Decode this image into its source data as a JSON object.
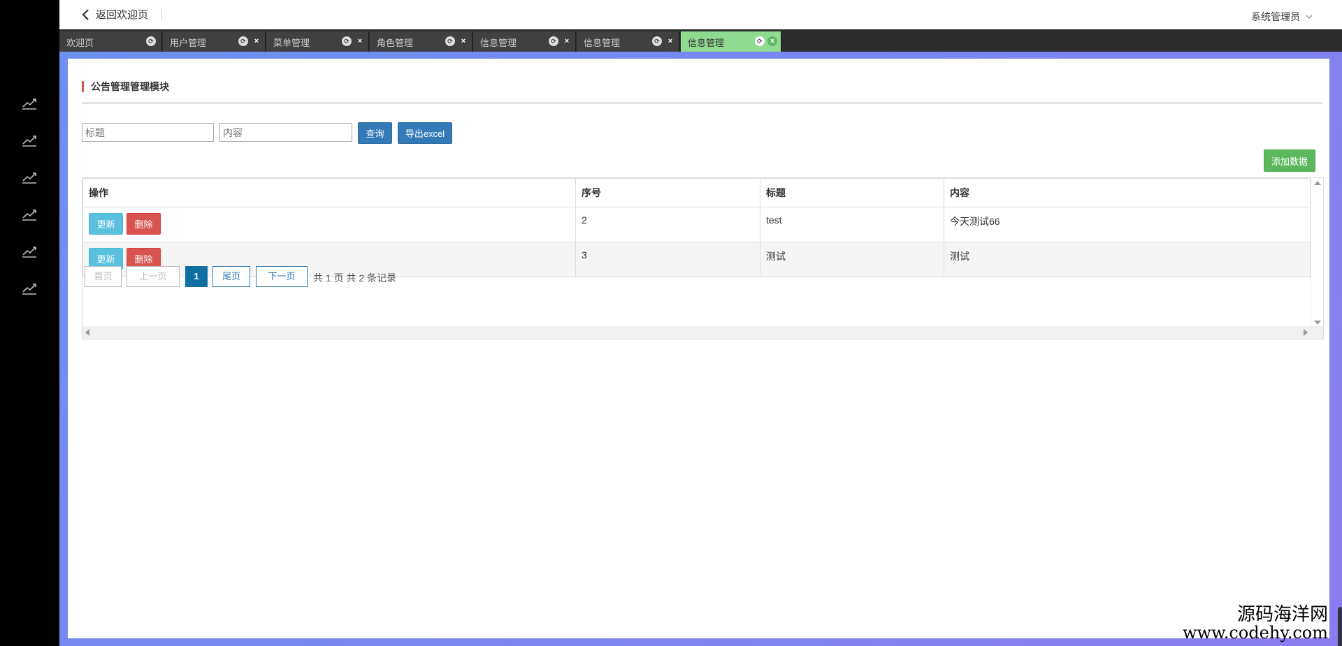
{
  "header": {
    "back_label": "返回欢迎页",
    "user_label": "系统管理员"
  },
  "tabs": [
    {
      "label": "欢迎页",
      "closable": false,
      "active": false
    },
    {
      "label": "用户管理",
      "closable": true,
      "active": false
    },
    {
      "label": "菜单管理",
      "closable": true,
      "active": false
    },
    {
      "label": "角色管理",
      "closable": true,
      "active": false
    },
    {
      "label": "信息管理",
      "closable": true,
      "active": false
    },
    {
      "label": "信息管理",
      "closable": true,
      "active": false
    },
    {
      "label": "信息管理",
      "closable": true,
      "active": true
    }
  ],
  "sidebar": {
    "icons": [
      "chart-line-icon",
      "chart-line-icon",
      "chart-line-icon",
      "chart-line-icon",
      "chart-line-icon",
      "chart-line-icon"
    ]
  },
  "page": {
    "section_title": "公告管理管理模块",
    "search": {
      "title_placeholder": "标题",
      "content_placeholder": "内容",
      "query_label": "查询",
      "export_label": "导出excel"
    },
    "add_label": "添加数据"
  },
  "table": {
    "columns": [
      "操作",
      "序号",
      "标题",
      "内容"
    ],
    "rows": [
      {
        "id": "2",
        "title": "test",
        "content": "今天测试66"
      },
      {
        "id": "3",
        "title": "测试",
        "content": "测试"
      }
    ],
    "update_label": "更新",
    "delete_label": "删除"
  },
  "pagination": {
    "first": "首页",
    "prev": "上一页",
    "current": "1",
    "last": "尾页",
    "next": "下一页",
    "info": "共 1 页 共 2 条记录"
  },
  "watermark": {
    "name": "源码海洋网",
    "url": "www.codehy.com"
  },
  "colors": {
    "primary": "#337ab7",
    "success": "#5cb85c",
    "info": "#5bc0de",
    "danger": "#d9534f",
    "active_tab": "#8fdb8f"
  }
}
